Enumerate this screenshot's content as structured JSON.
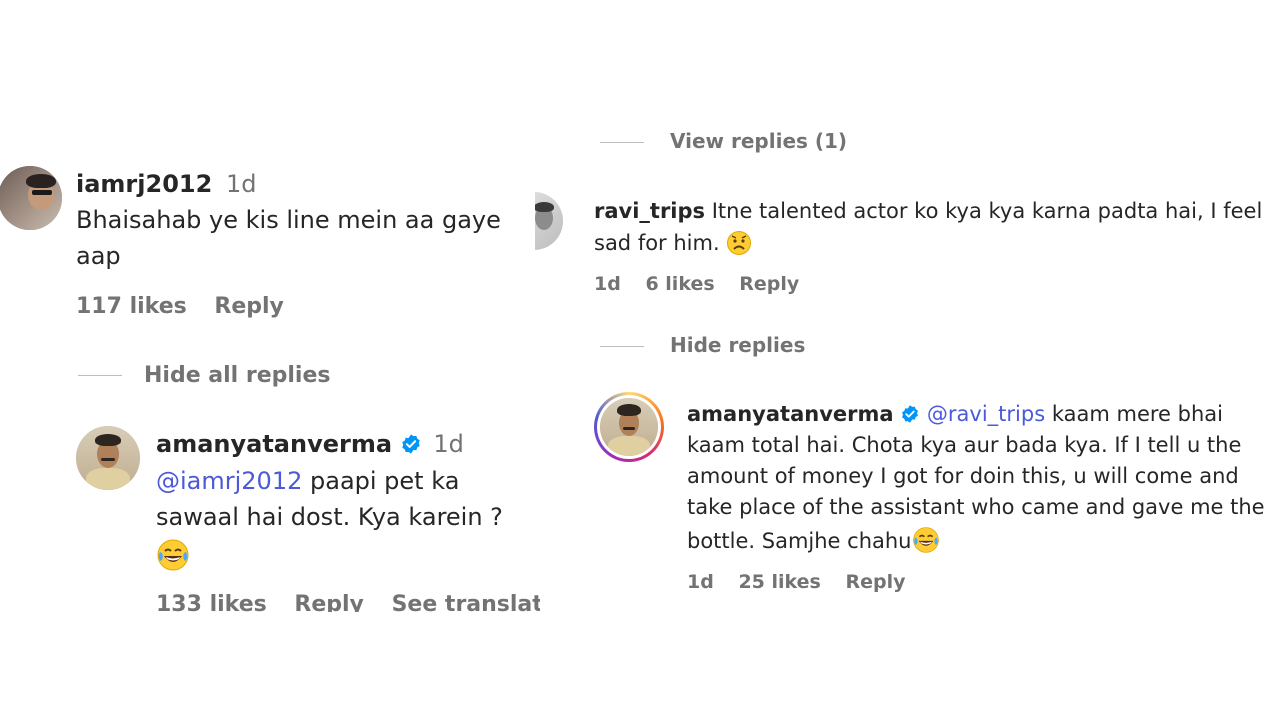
{
  "left": {
    "comment": {
      "username": "iamrj2012",
      "time": "1d",
      "text_line1": "Bhaisahab ye kis line mein aa gaye",
      "text_line2": "aap",
      "likes": "117 likes",
      "reply": "Reply"
    },
    "toggle": "Hide all replies",
    "reply": {
      "username": "amanyatanverma",
      "time": "1d",
      "mention": "@iamrj2012",
      "text_line1": " paapi pet ka",
      "text_line2": "sawaal hai dost. Kya karein ?",
      "likes": "133 likes",
      "reply": "Reply",
      "translation": "See translation"
    }
  },
  "right": {
    "view_replies": "View replies (1)",
    "comment": {
      "username": "ravi_trips",
      "text_line1": " Itne talented actor ko kya kya karna padta hai, I feel",
      "text_line2": "sad for him.",
      "time": "1d",
      "likes": "6 likes",
      "reply": "Reply"
    },
    "toggle": "Hide replies",
    "reply": {
      "username": "amanyatanverma",
      "mention": "@ravi_trips",
      "text_line1": " kaam mere bhai",
      "text_line2": "kaam total hai. Chota kya aur bada kya. If I tell u the",
      "text_line3": "amount of money I got for doin this, u will come and",
      "text_line4": "take place of the assistant who came and gave me the",
      "text_line5": "bottle. Samjhe chahu",
      "time": "1d",
      "likes": "25 likes",
      "reply": "Reply"
    }
  },
  "icons": {
    "verified": "verified-badge-icon",
    "laughing": "face-with-tears-of-joy-emoji",
    "sad": "sad-face-emoji"
  },
  "colors": {
    "mention": "#4a5ad9",
    "verified": "#0095f6",
    "muted": "#737373",
    "story_ring": "#d6249f"
  }
}
